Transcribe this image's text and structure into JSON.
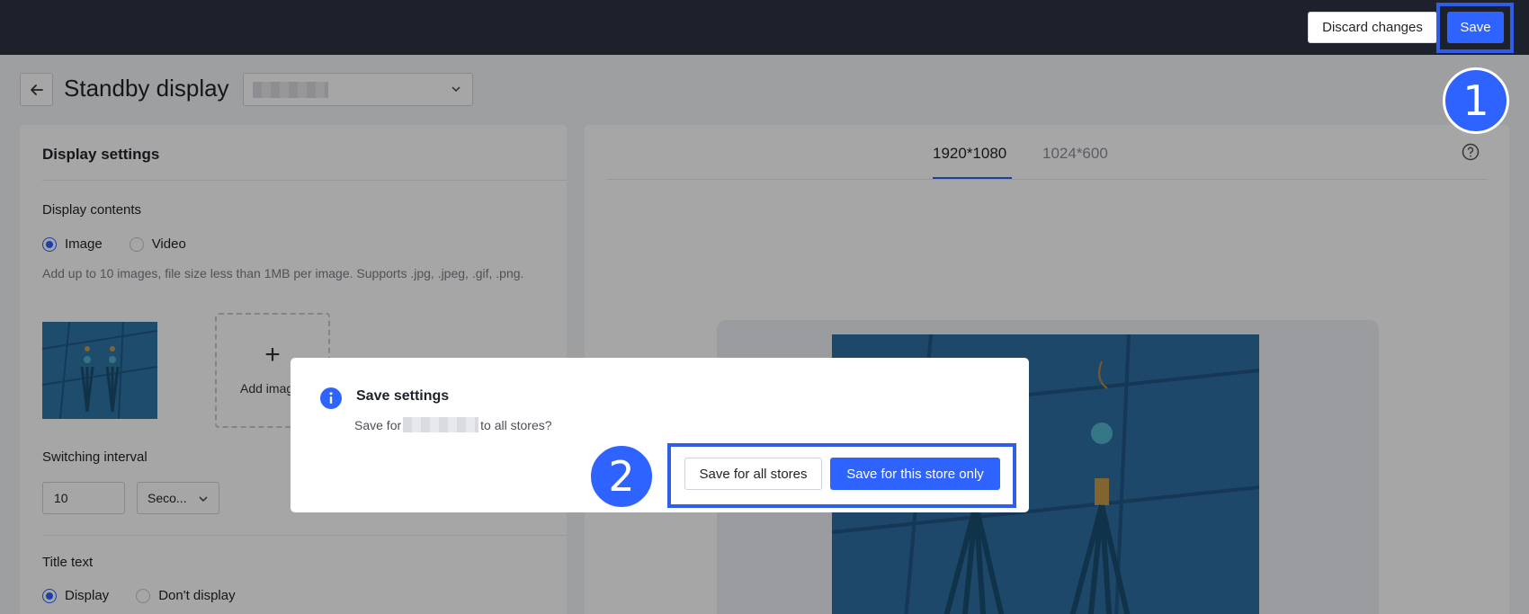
{
  "topbar": {
    "discard_label": "Discard changes",
    "save_label": "Save"
  },
  "header": {
    "title": "Standby display"
  },
  "settings": {
    "card_title": "Display settings",
    "display_contents_label": "Display contents",
    "content_options": [
      "Image",
      "Video"
    ],
    "selected_content": "Image",
    "hint": "Add up to 10 images, file size less than 1MB per image. Supports .jpg, .jpeg, .gif, .png.",
    "add_image_label": "Add image",
    "switching_interval_label": "Switching interval",
    "interval_value": "10",
    "interval_unit": "Seco...",
    "title_text_label": "Title text",
    "title_options": [
      "Display",
      "Don't display"
    ],
    "selected_title_option": "Display"
  },
  "preview": {
    "tabs": [
      "1920*1080",
      "1024*600"
    ],
    "active_tab": "1920*1080"
  },
  "dialog": {
    "title": "Save settings",
    "message_prefix": "Save for",
    "message_suffix": "to all stores?",
    "all_stores_label": "Save for all stores",
    "this_store_label": "Save for this store only"
  },
  "annotations": {
    "step1": "1",
    "step2": "2"
  },
  "colors": {
    "topbar": "#1d212b",
    "primary": "#2f63ff",
    "highlight": "#2f5de8"
  }
}
